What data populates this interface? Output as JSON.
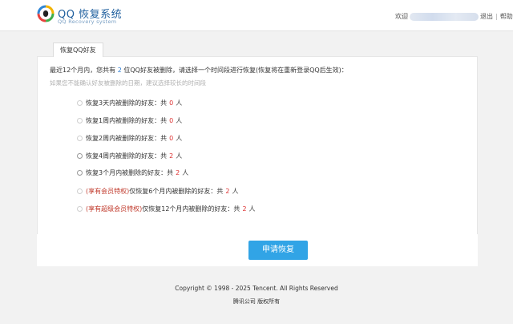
{
  "header": {
    "logo_title": "QQ 恢复系统",
    "logo_subtitle": "QQ Recovery system",
    "welcome_prefix": "欢迎",
    "logout": "退出",
    "help": "帮助"
  },
  "tab": {
    "label": "恢复QQ好友"
  },
  "intro": {
    "part1": "最近12个月内，您共有",
    "deleted_count": "2",
    "part2": "位QQ好友被删除，请选择一个时间段进行恢复(恢复将在重新登录QQ后生效)："
  },
  "hint": "如果您不能确认好友被删除的日期，建议选择较长的时间段",
  "options": [
    {
      "vip": "",
      "prefix": "恢复3天内被删除的好友：共",
      "count": "0",
      "unit": "人",
      "enabled": false
    },
    {
      "vip": "",
      "prefix": "恢复1周内被删除的好友：共",
      "count": "0",
      "unit": "人",
      "enabled": false
    },
    {
      "vip": "",
      "prefix": "恢复2周内被删除的好友：共",
      "count": "0",
      "unit": "人",
      "enabled": false
    },
    {
      "vip": "",
      "prefix": "恢复4周内被删除的好友：共",
      "count": "2",
      "unit": "人",
      "enabled": true
    },
    {
      "vip": "",
      "prefix": "恢复3个月内被删除的好友：共",
      "count": "2",
      "unit": "人",
      "enabled": true
    },
    {
      "vip": "(享有会员特权)",
      "prefix": "仅恢复6个月内被删除的好友：共",
      "count": "2",
      "unit": "人",
      "enabled": false
    },
    {
      "vip": "(享有超级会员特权)",
      "prefix": "仅恢复12个月内被删除的好友：共",
      "count": "2",
      "unit": "人",
      "enabled": false
    }
  ],
  "submit_label": "申请恢复",
  "footer": {
    "copyright": "Copyright © 1998 - 2025 Tencent. All Rights Reserved",
    "company": "腾讯公司 版权所有"
  }
}
